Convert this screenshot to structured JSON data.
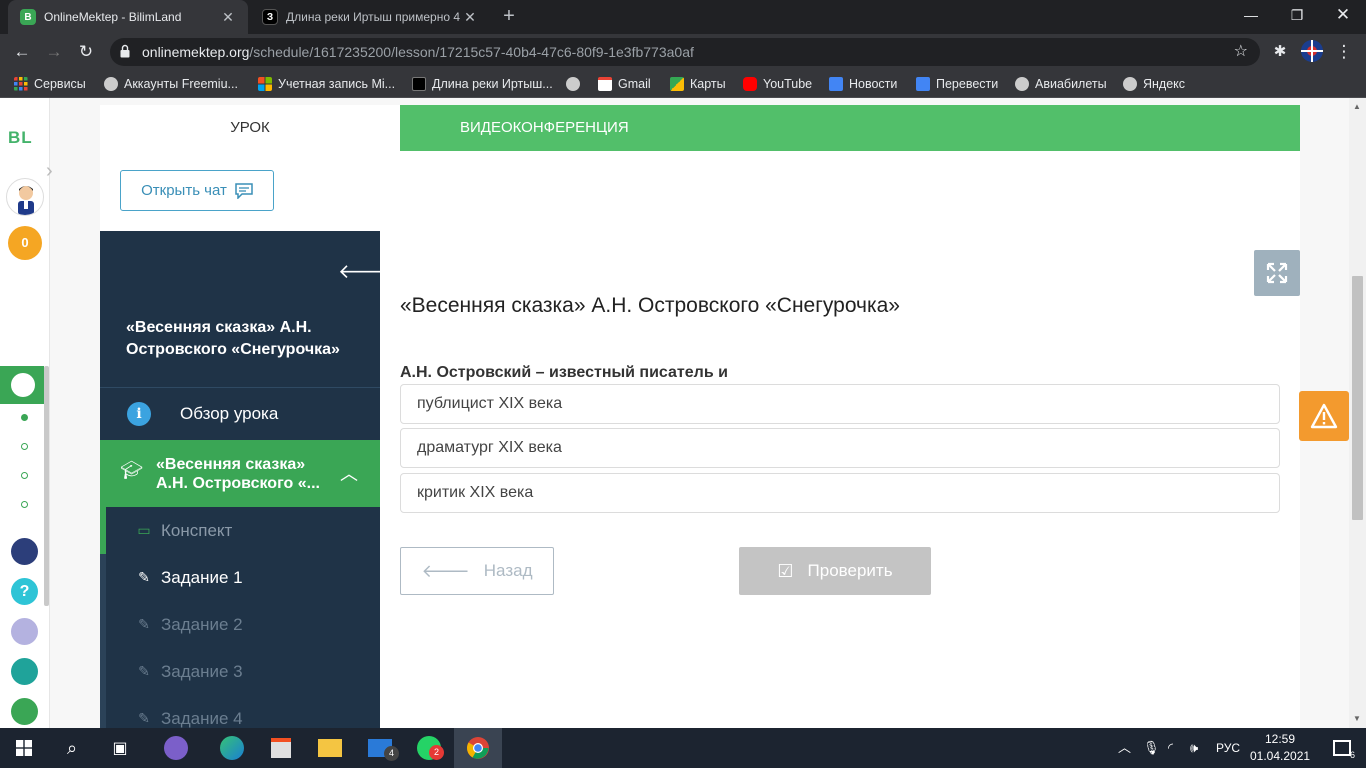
{
  "browser": {
    "tabs": [
      {
        "title": "OnlineMektep - BilimLand",
        "favicon": "bilimland-icon",
        "active": true
      },
      {
        "title": "Длина реки Иртыш примерно 4",
        "favicon": "znanija-icon",
        "active": false
      }
    ],
    "new_tab": "+",
    "url_host": "onlinemektep.org",
    "url_path": "/schedule/1617235200/lesson/17215c57-40b4-47c6-80f9-1e3fb773a0af",
    "bookmarks": [
      {
        "label": "Сервисы",
        "icon": "apps-grid-icon"
      },
      {
        "label": "Аккаунты Freemiu...",
        "icon": "globe-icon"
      },
      {
        "label": "Учетная запись Mi...",
        "icon": "microsoft-icon"
      },
      {
        "label": "Длина реки Иртыш...",
        "icon": "znanija-icon"
      },
      {
        "label": "",
        "icon": "globe-icon"
      },
      {
        "label": "Gmail",
        "icon": "gmail-icon"
      },
      {
        "label": "Карты",
        "icon": "maps-icon"
      },
      {
        "label": "YouTube",
        "icon": "youtube-icon"
      },
      {
        "label": "Новости",
        "icon": "news-icon"
      },
      {
        "label": "Перевести",
        "icon": "translate-icon"
      },
      {
        "label": "Авиабилеты",
        "icon": "globe-icon"
      },
      {
        "label": "Яндекс",
        "icon": "globe-icon"
      }
    ]
  },
  "rail": {
    "logo": "BL",
    "coins": "0"
  },
  "card": {
    "tab_lesson": "УРОК",
    "tab_video": "ВИДЕОКОНФЕРЕНЦИЯ",
    "chat_button": "Открыть чат"
  },
  "sidebar": {
    "title": "«Весенняя сказка» А.Н. Островского «Снегурочка»",
    "overview": "Обзор урока",
    "active_topic": "«Весенняя сказка» А.Н. Островского «...",
    "items": [
      {
        "label": "Конспект",
        "state": "done",
        "icon": "book-icon"
      },
      {
        "label": "Задание 1",
        "state": "current",
        "icon": "edit-icon"
      },
      {
        "label": "Задание 2",
        "state": "locked",
        "icon": "edit-icon"
      },
      {
        "label": "Задание 3",
        "state": "locked",
        "icon": "edit-icon"
      },
      {
        "label": "Задание 4",
        "state": "locked",
        "icon": "edit-icon"
      }
    ]
  },
  "main": {
    "lesson_title": "«Весенняя сказка» А.Н. Островского «Снегурочка»",
    "question": "А.Н. Островский – известный писатель и",
    "options": [
      "публицист XIX века",
      "драматург XIX века",
      "критик XIX века"
    ],
    "back_button": "Назад",
    "check_button": "Проверить"
  },
  "taskbar": {
    "lang": "РУС",
    "time": "12:59",
    "date": "01.04.2021",
    "mail_badge": "4",
    "whatsapp_badge": "2",
    "notif_count": "6"
  },
  "colors": {
    "green": "#52bf6a",
    "sidebar_dark": "#1f3347",
    "warning": "#f39a2e"
  }
}
